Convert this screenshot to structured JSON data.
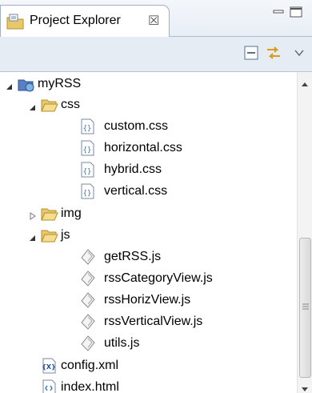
{
  "tab": {
    "title": "Project Explorer",
    "close_glyph": "☒"
  },
  "toolbar": {
    "collapse_all_icon": "collapse-all-icon",
    "link_editor_icon": "link-with-editor-icon",
    "view_menu_icon": "view-menu-icon"
  },
  "tree": {
    "project": {
      "label": "myRSS",
      "expanded": true,
      "icon": "web-project-icon"
    },
    "css": {
      "label": "css",
      "expanded": true,
      "files": [
        {
          "label": "custom.css"
        },
        {
          "label": "horizontal.css"
        },
        {
          "label": "hybrid.css"
        },
        {
          "label": "vertical.css"
        }
      ]
    },
    "img": {
      "label": "img",
      "expanded": false
    },
    "js": {
      "label": "js",
      "expanded": true,
      "files": [
        {
          "label": "getRSS.js"
        },
        {
          "label": "rssCategoryView.js"
        },
        {
          "label": "rssHorizView.js"
        },
        {
          "label": "rssVerticalView.js"
        },
        {
          "label": "utils.js"
        }
      ]
    },
    "root_files": [
      {
        "label": "config.xml",
        "icon": "xml-file-icon"
      },
      {
        "label": "index.html",
        "icon": "html-file-icon"
      }
    ]
  },
  "colors": {
    "folder": "#e9c86a",
    "folder_edge": "#b48f2c",
    "css_icon": "#3f74b8",
    "tab_border": "#9fb0c6",
    "toolbar_bg": "#e6ecf4"
  }
}
